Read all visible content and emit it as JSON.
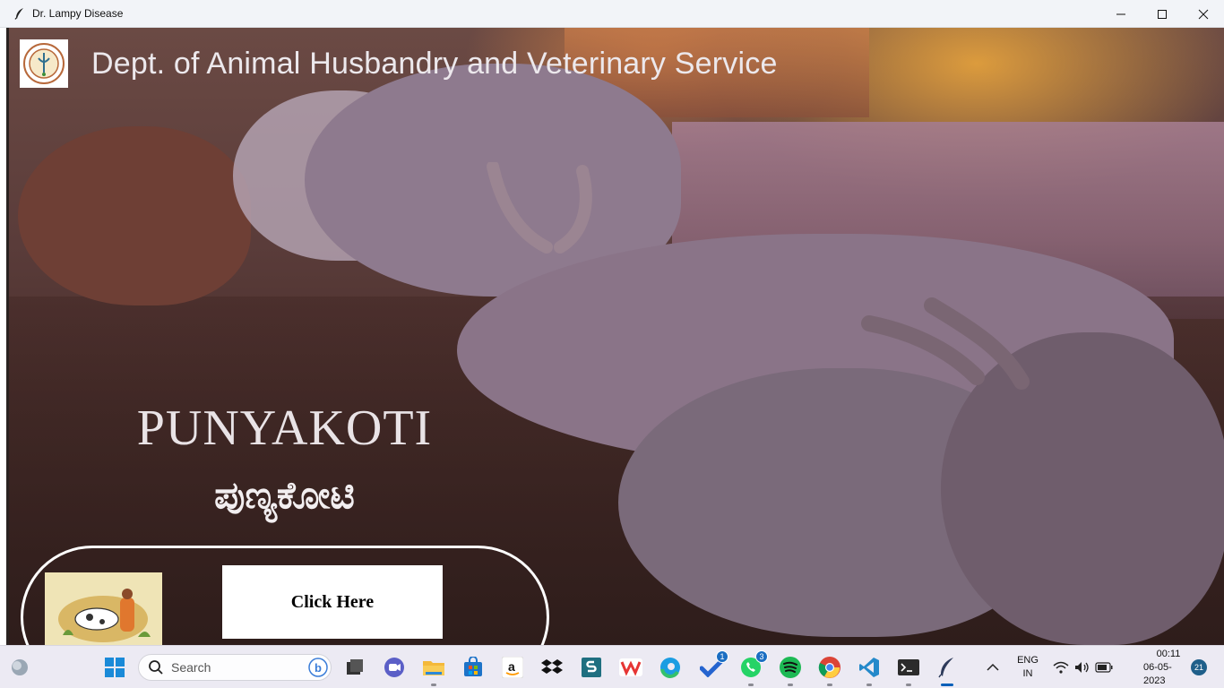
{
  "window": {
    "title": "Dr. Lampy Disease",
    "app_icon": "feather-icon",
    "controls": [
      "minimize-icon",
      "maximize-icon",
      "close-icon"
    ]
  },
  "header": {
    "title": "Dept. of Animal Husbandry and Veterinary Service",
    "logo_icon": "department-seal-logo"
  },
  "brand": {
    "name_en": "PUNYAKOTI",
    "name_kn": "ಪುಣ್ಯಕೋಟಿ"
  },
  "action": {
    "thumbnail_icon": "cow-and-farmer-illustration",
    "button_label": "Click Here"
  },
  "taskbar": {
    "search_placeholder": "Search",
    "apps": [
      {
        "name": "start-icon"
      },
      {
        "name": "task-view-icon"
      },
      {
        "name": "meet-icon"
      },
      {
        "name": "file-explorer-icon"
      },
      {
        "name": "store-icon"
      },
      {
        "name": "amazon-icon"
      },
      {
        "name": "dropbox-icon"
      },
      {
        "name": "slack-s-icon"
      },
      {
        "name": "wps-office-icon"
      },
      {
        "name": "edge-icon"
      },
      {
        "name": "todo-icon",
        "badge": "1"
      },
      {
        "name": "whatsapp-icon",
        "badge": "3"
      },
      {
        "name": "spotify-icon"
      },
      {
        "name": "chrome-icon"
      },
      {
        "name": "vscode-icon"
      },
      {
        "name": "terminal-icon"
      },
      {
        "name": "python-feather-icon"
      }
    ],
    "lang_line1": "ENG",
    "lang_line2": "IN",
    "time": "00:11",
    "date": "06-05-2023",
    "notifications": "21"
  },
  "colors": {
    "taskbar_bg": "#eceaf3",
    "titlebar_bg": "#f2f4f8",
    "accent": "#005fb8"
  }
}
